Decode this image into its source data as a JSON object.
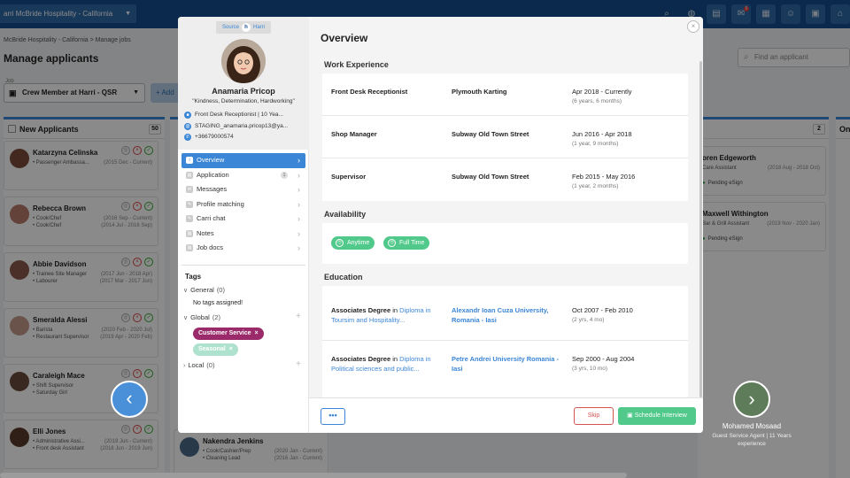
{
  "topbar": {
    "org": "arri  McBride Hospitality - California",
    "icons": [
      "search-icon",
      "globe-icon",
      "book-icon",
      "mail-icon",
      "grid-icon",
      "people-icon",
      "apps-icon",
      "home-icon"
    ],
    "mail_badge": "5"
  },
  "bg": {
    "breadcrumb": "McBride Hospitality - California  >  Manage jobs",
    "page_title": "Manage applicants",
    "search_placeholder": "Find an applicant",
    "job_label": "Job",
    "job_value": "Crew Member at Harri - QSR",
    "add_label": "+ Add",
    "col_new": {
      "title": "New Applicants",
      "count": "50"
    },
    "col_right": {
      "count": "2"
    },
    "col_far_title": "On",
    "cards": [
      {
        "name": "Katarzyna Celinska",
        "l1": "• Passenger Ambassa...",
        "d1": "(2015 Dec - Current)",
        "l2": "",
        "d2": ""
      },
      {
        "name": "Rebecca Brown",
        "l1": "• Cook/Chef",
        "d1": "(2016 Sep - Current)",
        "l2": "• Cook/Chef",
        "d2": "(2014 Jul - 2016 Sep)"
      },
      {
        "name": "Abbie Davidson",
        "l1": "• Trainee Site Manager",
        "d1": "(2017 Jun - 2018 Apr)",
        "l2": "• Labourer",
        "d2": "(2017 Mar - 2017 Jun)"
      },
      {
        "name": "Smeralda Alessi",
        "l1": "• Barista",
        "d1": "(2020 Feb - 2020 Jul)",
        "l2": "• Restaurant Supervisor",
        "d2": "(2019 Apr - 2020 Feb)"
      },
      {
        "name": "Caraleigh Mace",
        "l1": "• Shift Supervisor",
        "d1": "",
        "l2": "• Saturday Girl",
        "d2": ""
      },
      {
        "name": "Elli Jones",
        "l1": "• Administrative Assi...",
        "d1": "(2019 Jun - Current)",
        "l2": "• Front desk Assistant",
        "d2": "(2018 Jun - 2019 Jun)"
      }
    ],
    "second_col_card": {
      "name": "Nakendra Jenkins",
      "l1": "• Cook/Cashier/Prep",
      "d1": "(2020 Jan - Current)",
      "l2": "• Cleaning Lead",
      "d2": "(2016 Jan - Current)"
    },
    "right_cards": [
      {
        "name": "oren Edgeworth",
        "l1": "Care Assistant",
        "d1": "(2018 Aug - 2018 Oct)",
        "pending": "Pending eSign"
      },
      {
        "name": "Maxwell Withington",
        "l1": "Bar & Grill Assistant",
        "d1": "(2019 Nov - 2020 Jan)",
        "pending": "Pending eSign"
      }
    ]
  },
  "modal": {
    "source_label": "Source",
    "source_name": "Harri",
    "name": "Anamaria Pricop",
    "quote": "\"Kindness, Determination, Hardworking\"",
    "info": [
      {
        "icon": "briefcase-icon",
        "text": "Front Desk Receptionist | 10 Yea..."
      },
      {
        "icon": "email-icon",
        "text": "STAGING_anamaria.pricop13@ya..."
      },
      {
        "icon": "phone-icon",
        "text": "+36679000574"
      }
    ],
    "nav": [
      {
        "label": "Overview",
        "icon": "info-icon",
        "badge": ""
      },
      {
        "label": "Application",
        "icon": "document-icon",
        "badge": "1"
      },
      {
        "label": "Messages",
        "icon": "message-icon",
        "badge": ""
      },
      {
        "label": "Profile matching",
        "icon": "match-icon",
        "badge": ""
      },
      {
        "label": "Carri chat",
        "icon": "chat-icon",
        "badge": ""
      },
      {
        "label": "Notes",
        "icon": "notes-icon",
        "badge": ""
      },
      {
        "label": "Job docs",
        "icon": "docs-icon",
        "badge": ""
      }
    ],
    "tags": {
      "title": "Tags",
      "general": {
        "label": "General",
        "count": "(0)"
      },
      "no_tags": "No tags assigned!",
      "global": {
        "label": "Global",
        "count": "(2)"
      },
      "chips": [
        "Customer Service",
        "Seasonal"
      ],
      "local": {
        "label": "Local",
        "count": "(0)"
      }
    },
    "overview_title": "Overview",
    "work_title": "Work Experience",
    "work": [
      {
        "title": "Front Desk Receptionist",
        "company": "Plymouth Karting",
        "dates": "Apr 2018 - Currently",
        "duration": "(6 years, 6 months)"
      },
      {
        "title": "Shop Manager",
        "company": "Subway Old Town Street",
        "dates": "Jun 2016 - Apr 2018",
        "duration": "(1 year, 9 months)"
      },
      {
        "title": "Supervisor",
        "company": "Subway Old Town Street",
        "dates": "Feb 2015 - May 2016",
        "duration": "(1 year, 2 months)"
      }
    ],
    "availability_title": "Availability",
    "availability": [
      "Anytime",
      "Full Time"
    ],
    "education_title": "Education",
    "education": [
      {
        "degree": "Associates Degree",
        "in": "in",
        "field": "Diploma in Toursim and Hospitality...",
        "school": "Alexandr Ioan Cuza University, Romania - Iasi",
        "dates": "Oct 2007 - Feb 2010",
        "duration": "(2 yrs, 4 mo)"
      },
      {
        "degree": "Associates Degree",
        "in": "in",
        "field": "Diploma in Political sciences and public...",
        "school": "Petre Andrei University Romania - Iasi",
        "dates": "Sep 2000 - Aug 2004",
        "duration": "(3 yrs, 10 mo)"
      }
    ],
    "more_label": "•••",
    "skip_label": "Skip",
    "schedule_label": "Schedule Interview",
    "close_label": "×"
  },
  "carousel": {
    "next_name": "Mohamed Mosaad",
    "next_sub": "Guest Service Agent | 11 Years experience"
  },
  "colors": {
    "primary": "#3b86d6",
    "topbar": "#134d8c",
    "success": "#51c98a",
    "danger": "#d35353",
    "tag_customer_service": "#9b2a6a",
    "tag_seasonal": "#aee2cf"
  }
}
